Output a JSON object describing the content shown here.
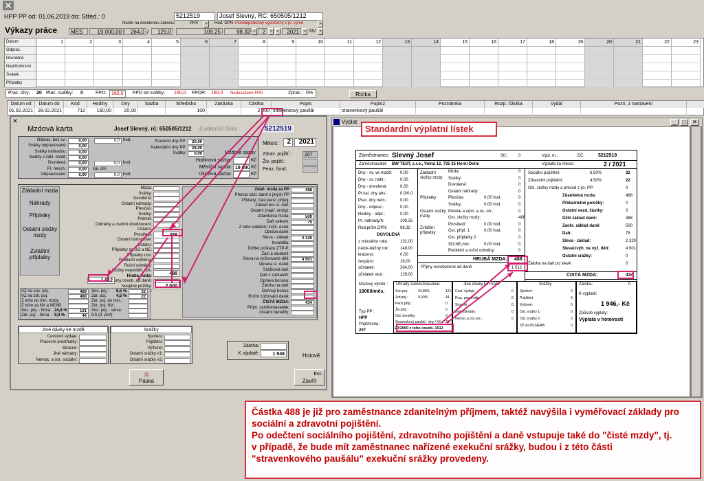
{
  "titlebar": {
    "close": "✕",
    "header_text": "HPP  PP od: 01.06.2019 do:        Střed.: 0",
    "id_value": "5212519",
    "person": "Josef  Slevný, RČ: 650505/1212"
  },
  "vykazy": {
    "title": "Výkazy práce",
    "mes_label": "MES",
    "narok_label": "Nárok na dovolenou zák/sku",
    "narok_a": "19 000,00",
    "narok_b": "264,0",
    "narok_c": "129,0",
    "phv_label": "PHV",
    "phv_value": "109,25",
    "red_dpn_label": "Red. DPN",
    "red_dpn_value": "98,3250",
    "pravdep": "Pravděpodobný výpočtený z pl. výmě",
    "year_prev": "2",
    "year": "2021",
    "nv": "NV"
  },
  "calendar": {
    "rows": [
      "Datum",
      "Odprac.",
      "Dovolená",
      "Nepřítomnost",
      "Svátek",
      "Příplatky"
    ],
    "days": [
      "1",
      "2",
      "3",
      "4",
      "5",
      "6",
      "7",
      "8",
      "9",
      "10",
      "11",
      "12",
      "13",
      "14",
      "15",
      "16",
      "17",
      "18",
      "19",
      "20",
      "21",
      "22",
      "23"
    ]
  },
  "statusbar": {
    "prac_dny_label": "Prac. dny:",
    "prac_dny": "20",
    "plac_svatky_label": "Plac. svátky:",
    "plac_svatky": "0",
    "fpd_label": "FPD:",
    "fpd": "160,0",
    "fpd_sv_label": "FPD se svátky:",
    "fpd_sv": "160,0",
    "fpdr_label": "FPDR:",
    "fpdr": "160,0",
    "nedosazeno": "Nedosažené FPD",
    "zprac_label": "Zprac.:",
    "zprac": "0%",
    "rizika": "Rizika"
  },
  "payments_table": {
    "headers": [
      "Datum od",
      "Datum do",
      "Kód",
      "Hodiny",
      "Dny",
      "Sazba",
      "Středisko",
      "Zakázka",
      "Částka",
      "Popis",
      "Popis2",
      "Poznámka",
      "Rozp. částka",
      "Vydal",
      "Pozn. z nastavení"
    ],
    "row": [
      "01.02.2021",
      "28.02.2021",
      "712",
      "160,00",
      "20,00",
      "",
      "100",
      "",
      "2 000",
      "stravenkový paušál",
      "stravenkový paušál",
      "",
      "",
      "",
      ""
    ]
  },
  "mzdova_karta": {
    "window_title": "",
    "title": "Mzdová karta",
    "person": "Josef  Slevný, rč: 650505/1212",
    "evid_label": "Evidenční číslo:",
    "evid_value": "5212519",
    "mesic_label": "Měsíc:",
    "mesic_m": "2",
    "mesic_y": "2021",
    "top_left": [
      [
        "Odprac. bez sv.:",
        "0,00",
        "0,0",
        "hod."
      ],
      [
        "Svátky odpracované:",
        "0,00",
        "",
        ""
      ],
      [
        "Svátky náhradou:",
        "0,00",
        "",
        ""
      ],
      [
        "Svátky v zákl. mzdě:",
        "0,00",
        "",
        ""
      ],
      [
        "Dovolená:",
        "0,00",
        "0,0",
        "hod."
      ],
      [
        "Pr. nesch.:",
        "0,00",
        "kal. dní",
        ""
      ],
      [
        "Odpracováno:",
        "0,00",
        "0,0",
        "hod."
      ]
    ],
    "top_mid": [
      [
        "Pracovní dny PP:",
        "20,00"
      ],
      [
        "Kalendářní dny PP:",
        "28,00"
      ],
      [
        "Svátky:",
        "0,00"
      ]
    ],
    "mzdove_sazby": "Mzdové sazby",
    "hod_sazba": "Hodinová sazba:",
    "mes_sazba": "Měsíční sazba:",
    "mes_sazba_v": "19 000",
    "uk_sazba": "Úkolová sazba:",
    "kc": "Kč",
    "zdrav": "Zdrav. pojišť.:",
    "zdrav_v": "207",
    "ziv": "Živ. pojišť.:",
    "penz": "Penz. fond:",
    "left_labels": [
      "Základní mzda",
      "Náhrady",
      "Příplatky",
      "Ostatní složky mzdy",
      "Zvláštní příplatky"
    ],
    "mid_labels": [
      "Mzda:",
      "Svátky:",
      "Dovolená:",
      "Ostatní náhrady:",
      "Přesčas:",
      "Svátky:",
      "Prémie:",
      "Odměny a osobní ohodnocení:",
      "Ostatní:",
      "Prostředí:",
      "Ostatní hodnotové:",
      "Ostatní:",
      "Příplatky za SO a NE:",
      "Příplatky noc:",
      "Pololetní odměny:",
      "Roční odměny:",
      "Složky nepodléh. odv.",
      "Hrubá mzda:",
      "Příjmy osvob. od daně:",
      "Neúplné požitky:",
      "Hrubý příjem:"
    ],
    "ostatni_v": "488",
    "hruba_v": "488",
    "prijmy_osvob_v": "1 512",
    "hruby_prijem_v": "2 000",
    "right_labels": [
      "Zdaň. mzda za PP",
      "Přenos zákl. daně z jiných PP",
      "Přidaný, část penz. připoj.",
      "Základ pro sr. daň:",
      "Ostatní (např. úroky):",
      "Zdanitelná mzda:",
      "Daň celkem:",
      "Z toho solidární zvýš. daně:",
      "Oprava daně:",
      "Sleva - základ:",
      "Invalidita:",
      "Držitel průkazu ZTP-P:",
      "Žáci a studenti:",
      "Sleva na vyživované děti:",
      "Oprava sr. daně:",
      "Srážková daň:",
      "Daň v zahraničí:",
      "Oprava bonusu:",
      "Záloha na daň:",
      "Daňový bonus:",
      "Roční zúčtování daně:",
      "ČISTÁ MZDA:",
      "Příjm. zaměstnavatele:",
      "Ostatní benefity:"
    ],
    "r_vals": {
      "zdan_mzda": "488",
      "zdanitelna": "500",
      "dan": "75",
      "sleva": "2 320",
      "deti": "4 901",
      "cista": "434"
    },
    "ins_labels": [
      "VZ na soc. poj.",
      "VZ na zdr. poj.",
      "Z toho do min. mzdy",
      "Z toho za NV a NEAB",
      "Soc. poj. - firma",
      "Zdr. poj. - firma"
    ],
    "ins_vals": [
      "488",
      "488",
      "",
      "",
      "121",
      "44"
    ],
    "ins_pct": [
      "24,8 %",
      "9,0 %"
    ],
    "ins_mid": [
      "Soc. poj.:",
      "Zdr. poj.:",
      "Zdr. poj. do min.:",
      "Zdr. poj. NV.:",
      "Soc. poj. - sleva:",
      "DS (II. pilíř):"
    ],
    "ins_mid_pct": [
      "6,5 %",
      "4,5 %"
    ],
    "ins_mid_vals": [
      "32",
      "22"
    ],
    "jine_title": "Jiné dávky ke mzdě",
    "jine": [
      "Cestovní výdaje:",
      "Pracovní prostředky:",
      "Stravné:",
      "Jiné náhrady:",
      "Nemoc. a ost. sociální:"
    ],
    "srazky_title": "Srážky",
    "srazky": [
      "Spoření:",
      "Pojištění:",
      "Výživné:",
      "Ostatní srážky #1:",
      "Ostatní srážky #2:"
    ],
    "zaloha_label": "Záloha:",
    "kvyplate_label": "K výplatě:",
    "kvyplate_v": "1 946",
    "hotove": "Hotově",
    "paska": "Páska",
    "esc": "Esc",
    "zavrit": "Zavřít"
  },
  "vyplata": {
    "window_title": "Výplat",
    "std_label": "Standardní výplatní lístek",
    "zam_label": "Zaměstnanec:",
    "zam_name": "Slevný  Josef",
    "str_label": "Stř.:",
    "str_v": "0",
    "vypl_label": "Výpl. m.:",
    "ec_label": "EČ:",
    "ec_v": "5212519",
    "zamest_label": "Zaměstnavatel:",
    "zamest_v": "BW TEST, s.r.o., Volná 12, 735 35  Horní Dolní",
    "vyplata_za": "Výplata za měsíc:",
    "vyplata_za_v": "2 / 2021",
    "left_rows": [
      [
        "Dny - sv. ve mzdě:",
        "0,00"
      ],
      [
        "Dny - sv. náhr.:",
        "0,00"
      ],
      [
        "Dny - dovolená:",
        "0,00"
      ],
      [
        "Pr.kal. dny abs.:",
        "0,0/0,0"
      ],
      [
        "Prac. dny nem.:",
        "0,00"
      ],
      [
        "Dny - odprac.:",
        "0,00"
      ],
      [
        "Hodiny - odpr.:",
        "0,00"
      ],
      [
        "Pr.-náhrady/h:",
        "109,25"
      ],
      [
        "Red.prům.DPN:",
        "98,32"
      ]
    ],
    "dovolena": "DOVOLENÁ",
    "dov_rows": [
      [
        "z minulého roku:",
        "132,00"
      ],
      [
        "nárok-běžný rok:",
        "148,00"
      ],
      [
        "kráceno:",
        "0,00"
      ],
      [
        "čerpáno:",
        "16,00"
      ],
      [
        "zůstatek:",
        "264,00"
      ],
      [
        "zůstatek skut.:",
        "129,00"
      ]
    ],
    "mid_groups": [
      "Základní složky mzdy",
      "Příplatky",
      "Ostatní složky mzdy",
      "Zvláštní příplatky"
    ],
    "mid_items": [
      [
        "Mzda:",
        "0"
      ],
      [
        "Svátky:",
        "0"
      ],
      [
        "Dovolená:",
        "0"
      ],
      [
        "Ostatní náhrady:",
        "0"
      ],
      [
        "Přesčas:",
        "0,00 hod.",
        "0"
      ],
      [
        "Svátky:",
        "0,00 hod.",
        "0"
      ],
      [
        "Prémie a odm. a os. oh.:",
        "0"
      ],
      [
        "Ost. složky mzdy:",
        "488"
      ],
      [
        "Prostředí:",
        "0,00 hod.",
        "0"
      ],
      [
        "Ost. přípl. 1:",
        "0,00 hod.",
        "0"
      ],
      [
        "Ost. příplatky 2:",
        "0"
      ],
      [
        "SO,NE,noc:",
        "0,00 hod.",
        "0"
      ],
      [
        "Pololetní a roční odměny:",
        "0"
      ]
    ],
    "hruba_label": "HRUBÁ MZDA:",
    "hruba_v": "488",
    "prijmy_osvob": "Příjmy osvobozené od daně",
    "prijmy_osvob_v": "1 512",
    "right_rows": [
      [
        "Sociální pojištění:",
        "6,50%",
        "32"
      ],
      [
        "Zdravotní pojištění:",
        "4,50%",
        "22"
      ],
      [
        "Ost. složky mzdy a převod z jin. PP:",
        "",
        "0"
      ],
      [
        "Zdanitelná mzda:",
        "",
        "488"
      ],
      [
        "Přidanitelné položky:",
        "",
        "0"
      ],
      [
        "Ostatní nezd. částky:",
        "",
        "0"
      ],
      [
        "Dílčí základ daně:",
        "",
        "488"
      ],
      [
        "Zaokr. základ daně:",
        "",
        "500"
      ],
      [
        "Daň:",
        "",
        "75"
      ],
      [
        "Sleva - základ:",
        "",
        "2 320"
      ],
      [
        "Sleva/zvýh. na vyž. dětí:",
        "",
        "4 901"
      ],
      [
        "Ostatní srážky:",
        "",
        "0"
      ],
      [
        "Záloha na daň po slevě",
        "",
        "0"
      ]
    ],
    "cista_label": "ČISTÁ MZDA:",
    "cista_v": "434",
    "vymer_label": "Mzdový výměr :",
    "vymer_v": "19000/měs.",
    "typ_pp": "Typ PP :",
    "typ_pp_v": "HPP",
    "pojistovna": "Pojišťovna :",
    "pojistovna_v": "207",
    "uhrady_title": "Úhrady zaměstnavatele:",
    "uhrady": [
      [
        "Soc.poj.:",
        "24,80%",
        "121"
      ],
      [
        "Zdr.poj.:",
        "9,00%",
        "44"
      ],
      [
        "Penz.příp.:",
        "",
        "0"
      ],
      [
        "Živ.příp.:",
        "",
        "0"
      ],
      [
        "Ost. benefity:",
        "",
        "0"
      ],
      [
        "Stravenkový paušál - dny / Kč :",
        "",
        "20"
      ]
    ],
    "stravenky_v": "20/2000 z toho osvob. 1512",
    "jine_title": "Jiné dávky ke mzdě",
    "jine": [
      [
        "Cest. výdaje:",
        "0"
      ],
      [
        "Prac. prostředky:",
        "0"
      ],
      [
        "Stravné:",
        "0"
      ],
      [
        "Jiné náhrady:",
        "0"
      ],
      [
        "Nemoc.a ost.soc.:",
        "0"
      ]
    ],
    "srazky_title": "Srážky",
    "srazky": [
      [
        "Spoření:",
        "0"
      ],
      [
        "Pojištění:",
        "0"
      ],
      [
        "Výživné:",
        "0"
      ],
      [
        "Ost. srážky 1:",
        "0"
      ],
      [
        "Ost. srážky 2:",
        "0"
      ],
      [
        "ZP za NV,NEAB:",
        "0"
      ]
    ],
    "zaloha_label": "Záloha:",
    "zaloha_v": "0",
    "kvyplate_label": "K výplatě:",
    "kvyplate_v": "1 946,- Kč",
    "zpusob": "Způsob výplaty:",
    "zpusob_v": "Výplata v hotovosti"
  },
  "note": {
    "line1": "Částka 488 je již pro zaměstnance zdanitelným příjmem, taktéž navýšila i vyměřovací základy pro",
    "line2": "sociální a zdravotní pojištění.",
    "line3": "Po odečtení sociálního pojištění, zdravotního pojištění a daně vstupuje také do \"čisté mzdy\", tj.",
    "line4": "v případě, že bude mít zaměstnanec nařízené exekuční srážky, budou i z této části",
    "line5": "\"stravenkového paušálu\" exekuční srážky provedeny."
  },
  "colors": {
    "accent": "#d32f3b",
    "arrow": "#d0206e",
    "red_text": "#c00000"
  }
}
